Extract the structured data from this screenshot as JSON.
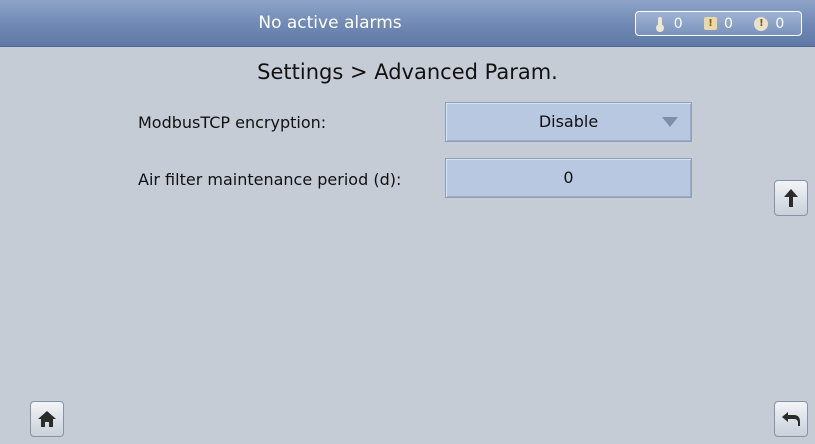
{
  "header": {
    "alarm_status": "No active alarms",
    "counters": [
      {
        "icon": "thermometer-icon",
        "value": "0"
      },
      {
        "icon": "minor-alarm-icon",
        "value": "0"
      },
      {
        "icon": "major-alarm-icon",
        "value": "0"
      }
    ]
  },
  "page": {
    "title": "Settings > Advanced Param."
  },
  "fields": {
    "modbus": {
      "label": "ModbusTCP encryption:",
      "value": "Disable"
    },
    "air_filter": {
      "label": "Air filter maintenance period (d):",
      "value": "0"
    }
  },
  "buttons": {
    "scroll_up_icon": "arrow-up-icon",
    "home_icon": "home-icon",
    "back_icon": "back-icon"
  },
  "colors": {
    "header_bar": "#6f88b4",
    "background": "#c6ccd6",
    "field_fill": "#b7c8e0"
  }
}
